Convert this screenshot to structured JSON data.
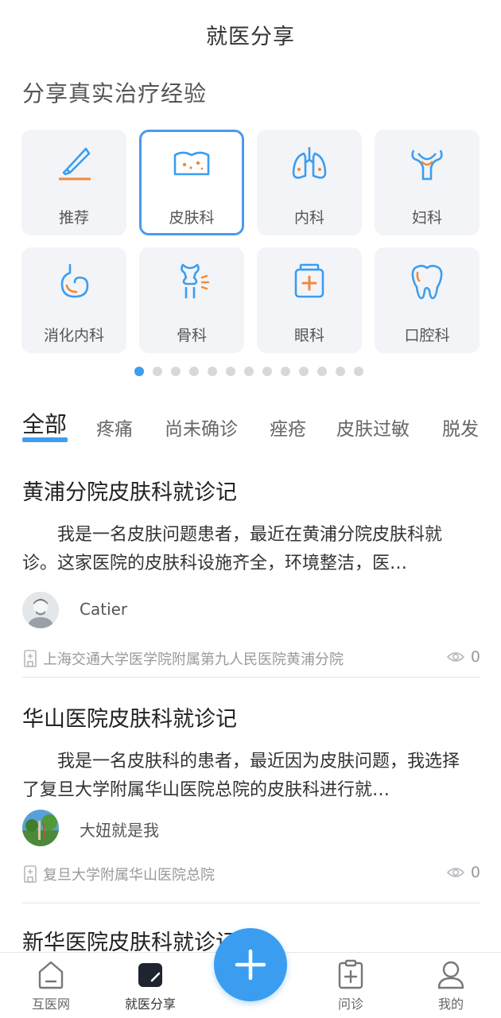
{
  "header": {
    "title": "就医分享"
  },
  "section": {
    "title": "分享真实治疗经验"
  },
  "categories": [
    {
      "label": "推荐",
      "icon": "scalpel-icon",
      "active": false
    },
    {
      "label": "皮肤科",
      "icon": "skin-icon",
      "active": true
    },
    {
      "label": "内科",
      "icon": "lungs-icon",
      "active": false
    },
    {
      "label": "妇科",
      "icon": "uterus-icon",
      "active": false
    },
    {
      "label": "消化内科",
      "icon": "stomach-icon",
      "active": false
    },
    {
      "label": "骨科",
      "icon": "bone-joint-icon",
      "active": false
    },
    {
      "label": "眼科",
      "icon": "medicine-box-icon",
      "active": false
    },
    {
      "label": "口腔科",
      "icon": "tooth-icon",
      "active": false
    }
  ],
  "pager": {
    "total": 13,
    "current": 1
  },
  "tabs": [
    {
      "label": "全部",
      "active": true
    },
    {
      "label": "疼痛"
    },
    {
      "label": "尚未确诊"
    },
    {
      "label": "痤疮"
    },
    {
      "label": "皮肤过敏"
    },
    {
      "label": "脱发"
    }
  ],
  "posts": [
    {
      "title": "黄浦分院皮肤科就诊记",
      "body": "我是一名皮肤问题患者，最近在黄浦分院皮肤科就诊。这家医院的皮肤科设施齐全，环境整洁，医…",
      "author": "Catier",
      "hospital": "上海交通大学医学院附属第九人民医院黄浦分院",
      "views": "0"
    },
    {
      "title": "华山医院皮肤科就诊记",
      "body": "我是一名皮肤科的患者，最近因为皮肤问题，我选择了复旦大学附属华山医院总院的皮肤科进行就…",
      "author": "大妞就是我",
      "hospital": "复旦大学附属华山医院总院",
      "views": "0"
    },
    {
      "title": "新华医院皮肤科就诊记"
    }
  ],
  "nav": [
    {
      "label": "互医网",
      "icon": "home-icon"
    },
    {
      "label": "就医分享",
      "icon": "note-icon",
      "active": true
    },
    {
      "label": "问诊",
      "icon": "clipboard-plus-icon"
    },
    {
      "label": "我的",
      "icon": "user-icon"
    }
  ],
  "colors": {
    "accent": "#3b9df0",
    "orange": "#f08a3c",
    "tileBg": "#f3f4f7"
  }
}
